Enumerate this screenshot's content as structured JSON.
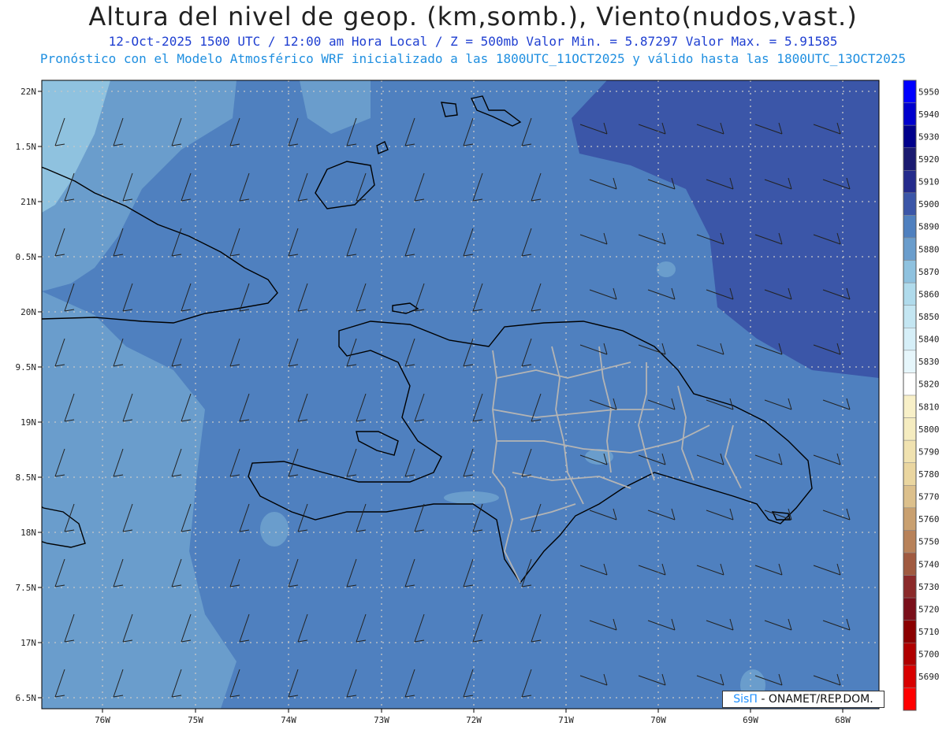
{
  "header": {
    "title": "Altura del nivel de geop. (km,somb.), Viento(nudos,vast.)",
    "subtitle1": "12-Oct-2025  1500 UTC / 12:00 am Hora Local / Z = 500mb   Valor Min. = 5.87297  Valor Max. = 5.91585",
    "subtitle2": "Pronóstico con el Modelo Atmosférico WRF inicializado a las 1800UTC_11OCT2025 y válido hasta las  1800UTC_13OCT2025"
  },
  "map": {
    "lat_ticks": [
      "22N",
      "1.5N",
      "21N",
      "0.5N",
      "20N",
      "9.5N",
      "19N",
      "8.5N",
      "18N",
      "7.5N",
      "17N",
      "6.5N"
    ],
    "lon_ticks": [
      "76W",
      "75W",
      "74W",
      "73W",
      "72W",
      "71W",
      "70W",
      "69W",
      "68W"
    ],
    "colors": {
      "fill_5870": "#8fc2df",
      "fill_5880": "#6a9dcc",
      "fill_5890": "#4f80bf",
      "fill_5900": "#3b56a8",
      "coast": "#000000",
      "borders": "#b4b4b4",
      "grid": "#c8c8c8",
      "barbs": "#222222"
    }
  },
  "legend": {
    "levels": [
      {
        "value": "5950",
        "color": "#0000ff"
      },
      {
        "value": "5940",
        "color": "#0000cd"
      },
      {
        "value": "5930",
        "color": "#00008b"
      },
      {
        "value": "5920",
        "color": "#1a1a70"
      },
      {
        "value": "5910",
        "color": "#242b8c"
      },
      {
        "value": "5900",
        "color": "#3b56a8"
      },
      {
        "value": "5890",
        "color": "#4f80bf"
      },
      {
        "value": "5880",
        "color": "#6a9dcc"
      },
      {
        "value": "5870",
        "color": "#8fc2df"
      },
      {
        "value": "5860",
        "color": "#b0dbec"
      },
      {
        "value": "5850",
        "color": "#c4e6f2"
      },
      {
        "value": "5840",
        "color": "#d6eff8"
      },
      {
        "value": "5830",
        "color": "#e6f6fb"
      },
      {
        "value": "5820",
        "color": "#ffffff"
      },
      {
        "value": "5810",
        "color": "#f8f0c8"
      },
      {
        "value": "5800",
        "color": "#f5ecc0"
      },
      {
        "value": "5790",
        "color": "#f0e2b0"
      },
      {
        "value": "5780",
        "color": "#ead6a0"
      },
      {
        "value": "5770",
        "color": "#dcc08c"
      },
      {
        "value": "5760",
        "color": "#c9a070"
      },
      {
        "value": "5750",
        "color": "#b8825a"
      },
      {
        "value": "5740",
        "color": "#a05a40"
      },
      {
        "value": "5730",
        "color": "#8b2a2a"
      },
      {
        "value": "5720",
        "color": "#7a0f1a"
      },
      {
        "value": "5710",
        "color": "#8b0000"
      },
      {
        "value": "5700",
        "color": "#b00000"
      },
      {
        "value": "5690",
        "color": "#d80000"
      },
      {
        "value": "",
        "color": "#ff0000"
      }
    ]
  },
  "credit": {
    "brand": "SisΠ",
    "text": " - ONAMET/REP.DOM."
  }
}
